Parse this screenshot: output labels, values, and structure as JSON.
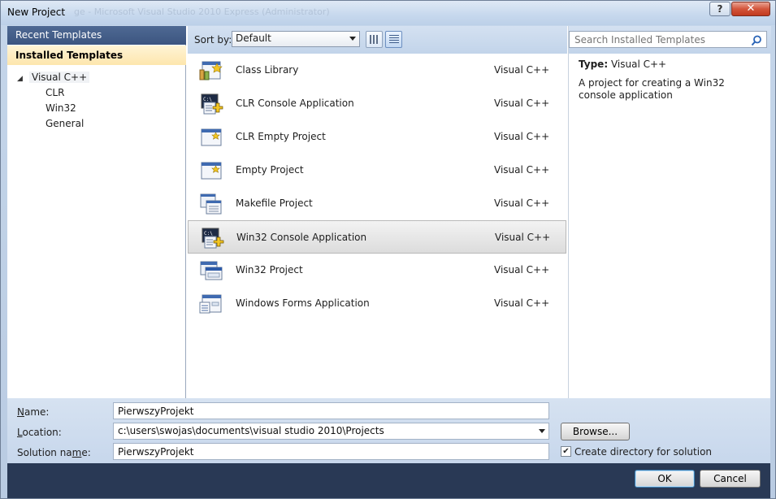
{
  "window": {
    "title": "New Project",
    "title_ghost": "ge - Microsoft Visual Studio 2010 Express (Administrator)",
    "help_glyph": "?",
    "close_glyph": "✕"
  },
  "left": {
    "recent_label": "Recent Templates",
    "installed_label": "Installed Templates",
    "tree": {
      "root": "Visual C++",
      "children": [
        "CLR",
        "Win32",
        "General"
      ]
    }
  },
  "toolbar": {
    "sort_label": "Sort by:",
    "sort_value": "Default"
  },
  "templates": [
    {
      "name": "Class Library",
      "lang": "Visual C++",
      "icon": "class-library-icon"
    },
    {
      "name": "CLR Console Application",
      "lang": "Visual C++",
      "icon": "console-app-icon"
    },
    {
      "name": "CLR Empty Project",
      "lang": "Visual C++",
      "icon": "empty-project-icon"
    },
    {
      "name": "Empty Project",
      "lang": "Visual C++",
      "icon": "empty-project-icon"
    },
    {
      "name": "Makefile Project",
      "lang": "Visual C++",
      "icon": "makefile-project-icon"
    },
    {
      "name": "Win32 Console Application",
      "lang": "Visual C++",
      "icon": "console-app-icon",
      "selected": true
    },
    {
      "name": "Win32 Project",
      "lang": "Visual C++",
      "icon": "win32-project-icon"
    },
    {
      "name": "Windows Forms Application",
      "lang": "Visual C++",
      "icon": "windows-forms-icon"
    }
  ],
  "details": {
    "search_placeholder": "Search Installed Templates",
    "type_label": "Type:",
    "type_value": "Visual C++",
    "description": "A project for creating a Win32 console application"
  },
  "form": {
    "name_label_underlined": "N",
    "name_label_rest": "ame:",
    "name_value": "PierwszyProjekt",
    "location_label_underlined": "L",
    "location_label_rest": "ocation:",
    "location_value": "c:\\users\\swojas\\documents\\visual studio 2010\\Projects",
    "browse_label": "Browse...",
    "solution_label_pre": "Solution na",
    "solution_label_underlined": "m",
    "solution_label_rest": "e:",
    "solution_value": "PierwszyProjekt",
    "create_dir_checked": true,
    "create_dir_label": "Create directory for solution"
  },
  "buttons": {
    "ok": "OK",
    "cancel": "Cancel"
  },
  "colors": {
    "accent": "#3c5580",
    "selected_category": "#fde6ad",
    "footer": "#293955"
  }
}
